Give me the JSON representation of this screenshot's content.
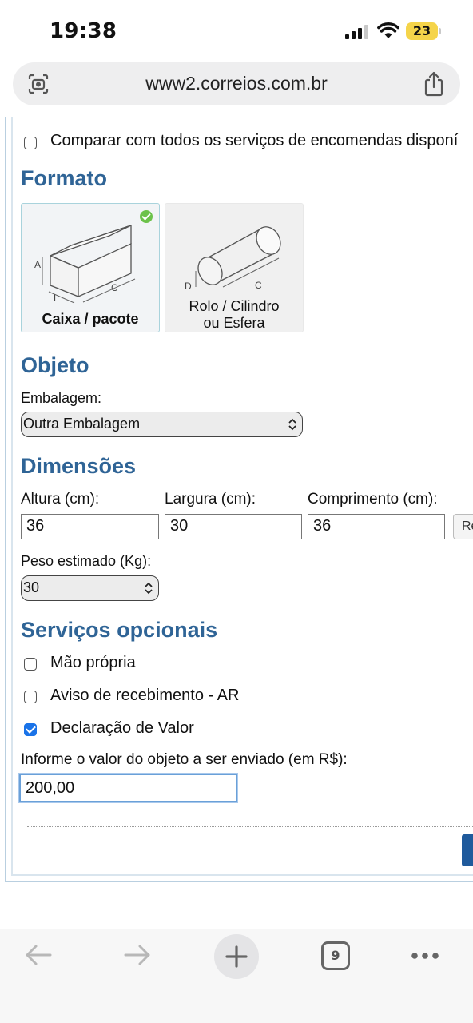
{
  "status_bar": {
    "time": "19:38",
    "battery_level": "23",
    "icons": [
      "signal-icon",
      "wifi-icon",
      "battery-icon"
    ]
  },
  "browser": {
    "url": "www2.correios.com.br",
    "icons": [
      "lens-icon",
      "share-icon"
    ]
  },
  "form": {
    "compare_label": "Comparar com todos os serviços de encomendas disponí",
    "compare_checked": false,
    "formato_title": "Formato",
    "formats": [
      {
        "label": "Caixa / pacote",
        "selected": true
      },
      {
        "label_line1": "Rolo / Cilindro",
        "label_line2": "ou Esfera",
        "selected": false
      }
    ],
    "diagram_letters": {
      "a": "A",
      "l": "L",
      "c": "C",
      "d": "D"
    },
    "objeto_title": "Objeto",
    "embalagem_label": "Embalagem:",
    "embalagem_value": "Outra Embalagem",
    "dimensoes_title": "Dimensões",
    "altura_label": "Altura (cm):",
    "altura_value": "36",
    "largura_label": "Largura (cm):",
    "largura_value": "30",
    "comprimento_label": "Comprimento (cm):",
    "comprimento_value": "36",
    "side_button_label": "Re",
    "peso_label": "Peso estimado (Kg):",
    "peso_value": "30",
    "servicos_title": "Serviços opcionais",
    "services": [
      {
        "label": "Mão própria",
        "checked": false
      },
      {
        "label": "Aviso de recebimento - AR",
        "checked": false
      },
      {
        "label": "Declaração de Valor",
        "checked": true
      }
    ],
    "valor_label": "Informe o valor do objeto a ser enviado (em R$):",
    "valor_value": "200,00"
  },
  "toolbar": {
    "tabs_count": "9",
    "icons": [
      "back-arrow-icon",
      "forward-arrow-icon",
      "plus-icon",
      "tabs-icon",
      "more-icon"
    ]
  },
  "colors": {
    "section_title": "#2f6496",
    "checkbox_checked": "#1a73e8",
    "check_badge": "#6cc24a",
    "battery": "#f5d44a"
  }
}
